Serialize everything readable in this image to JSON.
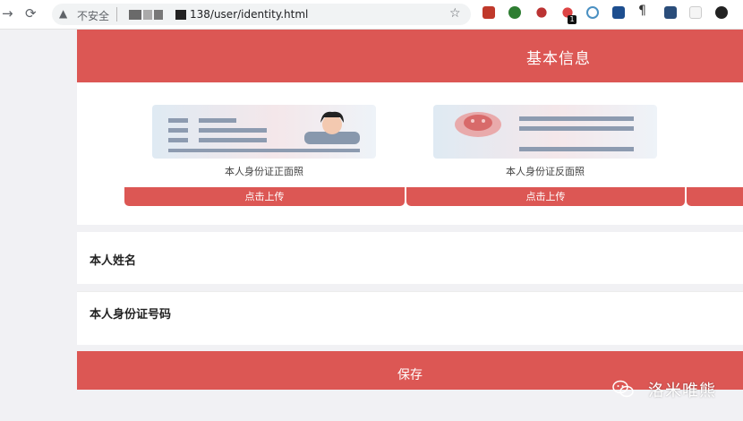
{
  "browser": {
    "security_label": "不安全",
    "url_visible": "138/user/identity.html",
    "extension_badge": "1"
  },
  "page": {
    "header_title": "基本信息",
    "id_cards": [
      {
        "caption": "本人身份证正面照",
        "upload_label": "点击上传"
      },
      {
        "caption": "本人身份证反面照",
        "upload_label": "点击上传"
      }
    ],
    "fields": {
      "name_label": "本人姓名",
      "id_number_label": "本人身份证号码"
    },
    "save_label": "保存"
  },
  "watermark": {
    "text": "洛米唯熊",
    "icon": "wechat-icon"
  },
  "colors": {
    "accent": "#dc5754",
    "background": "#f1f1f4"
  }
}
